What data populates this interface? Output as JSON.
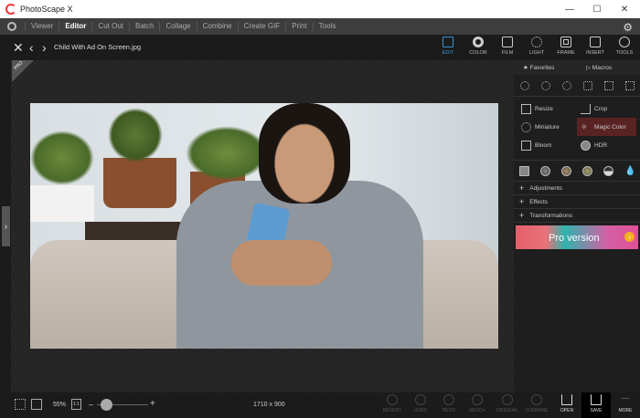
{
  "window": {
    "title": "PhotoScape X",
    "minimize": "—",
    "maximize": "☐",
    "close": "✕"
  },
  "menu": [
    "Viewer",
    "Editor",
    "Cut Out",
    "Batch",
    "Collage",
    "Combine",
    "Create GIF",
    "Print",
    "Tools"
  ],
  "active_menu": "Editor",
  "file": {
    "name": "Child With Ad On Screen.jpg"
  },
  "tools": [
    {
      "label": "EDIT",
      "active": true
    },
    {
      "label": "COLOR"
    },
    {
      "label": "FILM"
    },
    {
      "label": "LIGHT"
    },
    {
      "label": "FRAME"
    },
    {
      "label": "INSERT"
    },
    {
      "label": "TOOLS"
    }
  ],
  "badge": "PRO",
  "panel": {
    "tabs": [
      "★  Favorites",
      "▷  Macros"
    ],
    "edit_items": [
      "Resize",
      "Crop",
      "Miniature",
      "Magic Color",
      "Bloom",
      "HDR"
    ],
    "highlighted": "Magic Color",
    "sections": [
      "Adjustments",
      "Effects",
      "Transformations"
    ],
    "banner": "Pro version",
    "banner_arrow": "›"
  },
  "bottom": {
    "zoom": "55%",
    "actual_size": "1:1",
    "minus": "–",
    "plus": "+",
    "dimensions": "1710 x 900",
    "actions": [
      {
        "label": "REVERT"
      },
      {
        "label": "UNDO"
      },
      {
        "label": "REDO"
      },
      {
        "label": "REDO+"
      },
      {
        "label": "ORIGINAL"
      },
      {
        "label": "COMPARE"
      },
      {
        "label": "OPEN",
        "enabled": true
      },
      {
        "label": "SAVE",
        "enabled": true
      },
      {
        "label": "MORE",
        "enabled": true
      }
    ]
  },
  "colors": {
    "accent": "#3a9ad9",
    "highlight": "#5a2323",
    "menubar": "#3d3d3d"
  }
}
